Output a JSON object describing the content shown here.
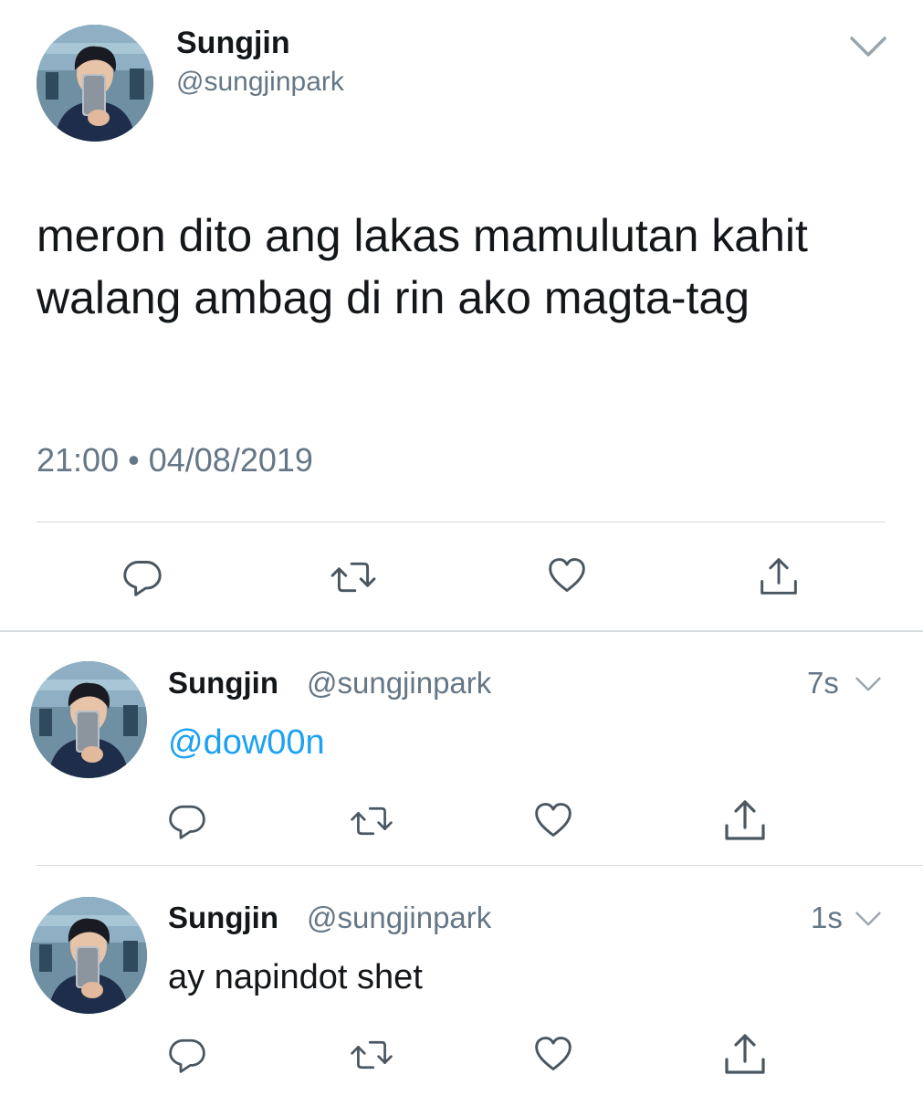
{
  "main_tweet": {
    "display_name": "Sungjin",
    "handle": "@sungjinpark",
    "text": "meron dito ang lakas mamulutan kahit walang ambag di rin ako magta-tag",
    "time": "21:00",
    "separator": "•",
    "date": "04/08/2019",
    "actions": [
      "reply-icon",
      "retweet-icon",
      "like-icon",
      "share-icon"
    ]
  },
  "replies": [
    {
      "display_name": "Sungjin",
      "handle": "@sungjinpark",
      "time": "7s",
      "text": "@dow00n",
      "actions": [
        "reply-icon",
        "retweet-icon",
        "like-icon",
        "share-icon"
      ]
    },
    {
      "display_name": "Sungjin",
      "handle": "@sungjinpark",
      "time": "1s",
      "text": "ay napindot shet",
      "actions": [
        "reply-icon",
        "retweet-icon",
        "like-icon",
        "share-icon"
      ]
    }
  ],
  "colors": {
    "text": "#14171a",
    "secondary": "#657786",
    "link": "#1da1f2",
    "divider": "#d3d9de"
  }
}
